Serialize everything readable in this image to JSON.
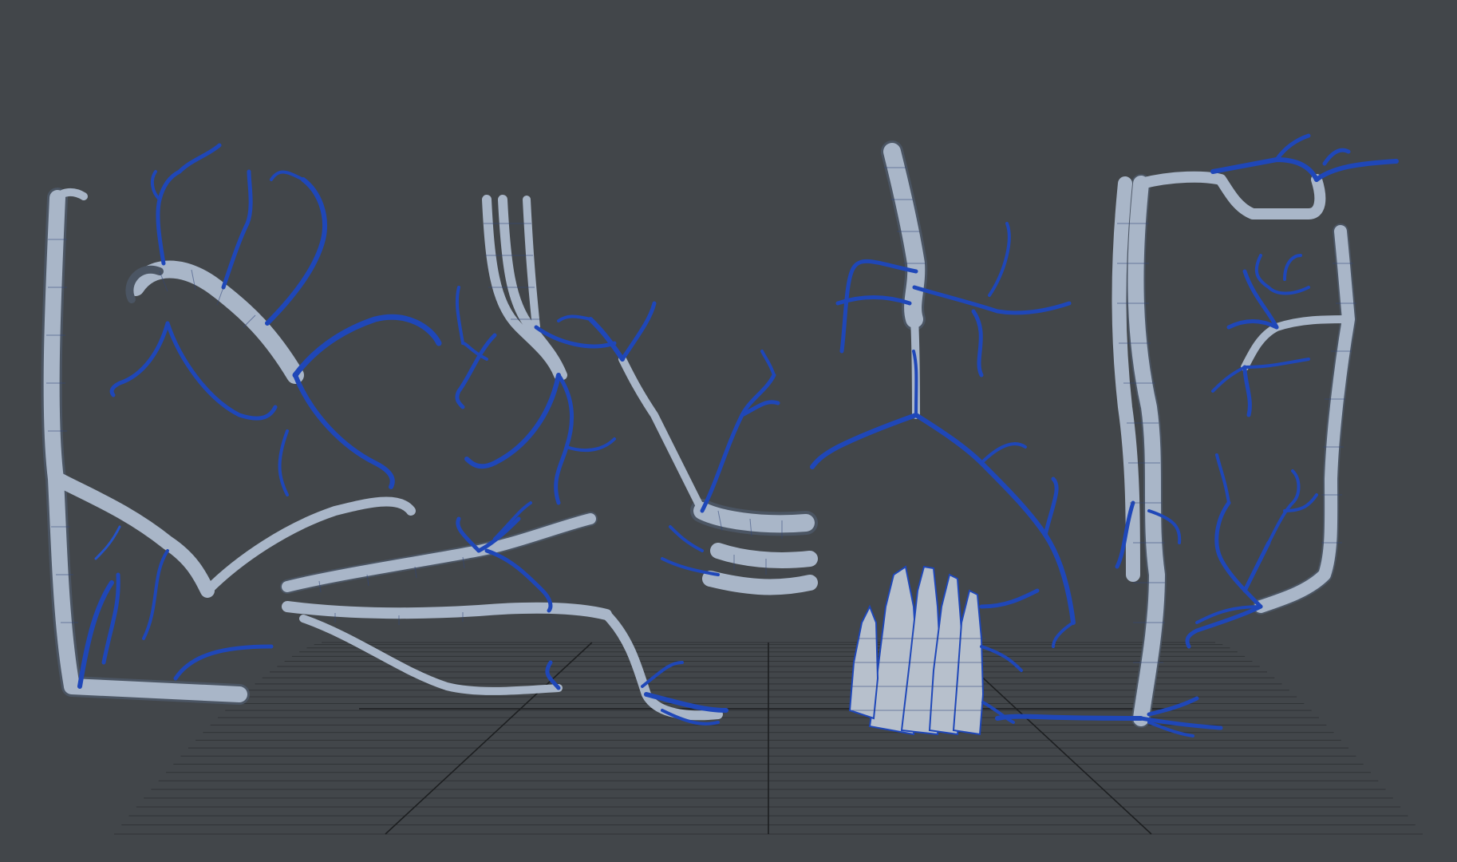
{
  "app": {
    "viewport_mode": "3d-perspective-viewport"
  },
  "colors": {
    "background": "#42464a",
    "mesh_wire": "#1f47b8",
    "mesh_surface": "#a9b6c8",
    "ground_grid": "#2a2d30"
  },
  "objects": [
    {
      "name": "root-cluster-left"
    },
    {
      "name": "branching-roots-left"
    },
    {
      "name": "curled-branch-center-left"
    },
    {
      "name": "root-tangle-center"
    },
    {
      "name": "vertical-roots-center"
    },
    {
      "name": "twisted-pillar-right-center"
    },
    {
      "name": "root-pile-bottom"
    },
    {
      "name": "tall-roots-right"
    },
    {
      "name": "roots-far-right"
    }
  ]
}
